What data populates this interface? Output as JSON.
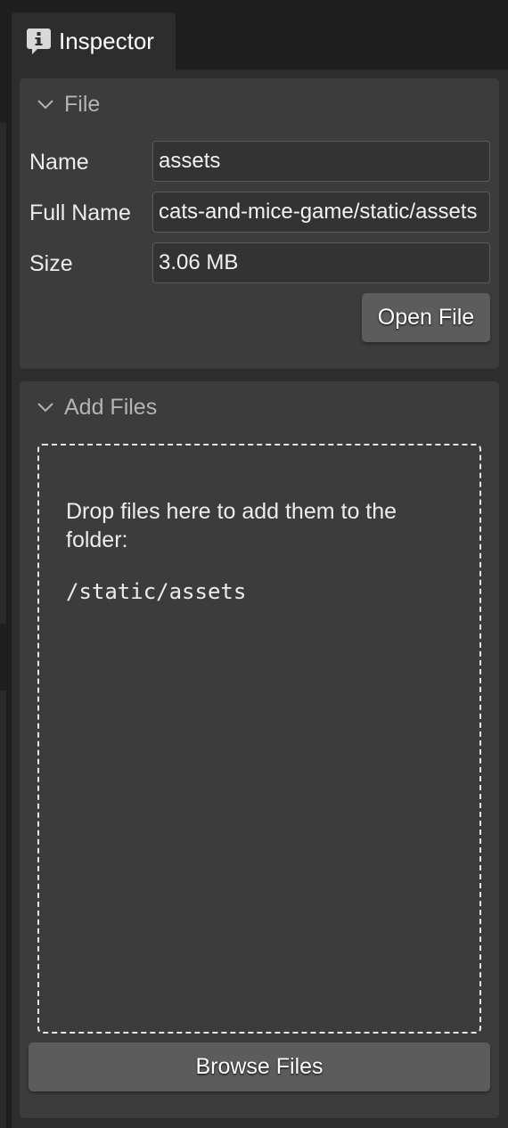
{
  "tab": {
    "icon": "info-icon",
    "label": "Inspector"
  },
  "file_section": {
    "title": "File",
    "fields": [
      {
        "label": "Name",
        "value": "assets"
      },
      {
        "label": "Full Name",
        "value": "cats-and-mice-game/static/assets"
      },
      {
        "label": "Size",
        "value": "3.06 MB"
      }
    ],
    "open_button": "Open File"
  },
  "add_section": {
    "title": "Add Files",
    "drop_text": "Drop files here to add them to the folder:",
    "drop_path": "/static/assets",
    "browse_button": "Browse Files"
  },
  "colors": {
    "background": "#1f1f1f",
    "panel": "#2d2d2d",
    "section": "#3c3c3c",
    "input_bg": "#333333",
    "button": "#5c5c5c"
  }
}
